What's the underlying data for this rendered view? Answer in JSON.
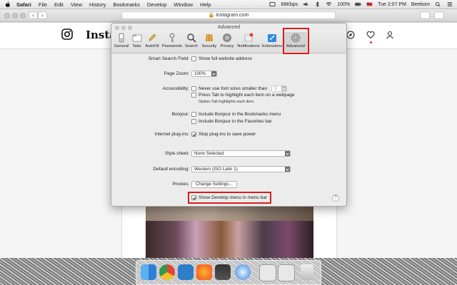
{
  "menubar": {
    "items": [
      "Safari",
      "File",
      "Edit",
      "View",
      "History",
      "Bookmarks",
      "Develop",
      "Window",
      "Help"
    ],
    "network_speed": "68Kbps",
    "battery": "100%",
    "clock": "Tue 2:07 PM",
    "user": "Beebom"
  },
  "browser": {
    "url": "instagram.com",
    "back": "‹",
    "forward": "›"
  },
  "instagram": {
    "wordmark": "Instag"
  },
  "prefs": {
    "title": "Advanced",
    "tabs": [
      "General",
      "Tabs",
      "AutoFill",
      "Passwords",
      "Search",
      "Security",
      "Privacy",
      "Notifications",
      "Extensions",
      "Advanced"
    ],
    "active_tab": "Advanced",
    "smart_search": {
      "label": "Smart Search Field:",
      "option": "Show full website address",
      "checked": false
    },
    "page_zoom": {
      "label": "Page Zoom:",
      "value": "100%"
    },
    "accessibility": {
      "label": "Accessibility:",
      "font_size_option": "Never use font sizes smaller than",
      "font_size_value": "9",
      "tab_option": "Press Tab to highlight each item on a webpage",
      "tab_note": "Option-Tab highlights each item."
    },
    "bonjour": {
      "label": "Bonjour:",
      "bookmarks_menu": "Include Bonjour in the Bookmarks menu",
      "favorites_bar": "Include Bonjour in the Favorites bar"
    },
    "plugins": {
      "label": "Internet plug-ins:",
      "option": "Stop plug-ins to save power",
      "checked": true
    },
    "style_sheet": {
      "label": "Style sheet:",
      "value": "None Selected"
    },
    "encoding": {
      "label": "Default encoding:",
      "value": "Western (ISO Latin 1)"
    },
    "proxies": {
      "label": "Proxies:",
      "button": "Change Settings..."
    },
    "develop": {
      "option": "Show Develop menu in menu bar",
      "checked": true
    },
    "help": "?"
  },
  "colors": {
    "highlight": "#d91c1c"
  }
}
